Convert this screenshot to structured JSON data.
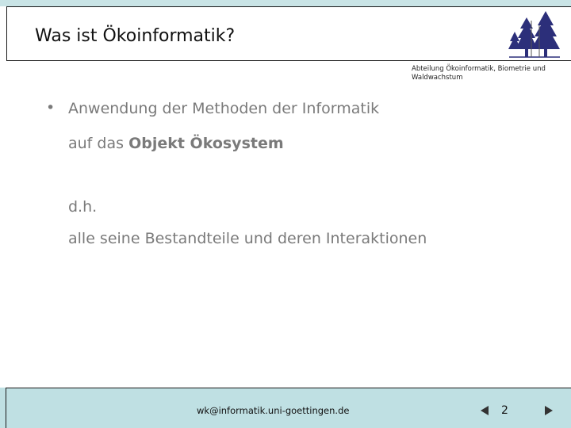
{
  "slide": {
    "title": "Was ist Ökoinformatik?",
    "department": "Abteilung Ökoinformatik, Biometrie und Waldwachstum",
    "bullet_symbol": "•",
    "lines": [
      {
        "text": "Anwendung der Methoden der Informatik"
      },
      {
        "prefix": "auf das ",
        "bold": "Objekt Ökosystem"
      },
      {
        "text": "d.h."
      },
      {
        "text": "alle seine Bestandteile und deren Interaktionen"
      }
    ]
  },
  "footer": {
    "email": "wk@informatik.uni-goettingen.de",
    "page_number": "2"
  },
  "colors": {
    "accent_band": "#c9e4e6",
    "footer_bg": "#bfe0e3",
    "body_text": "#7a7a7a",
    "logo_trees": "#2c2f7a"
  },
  "icons": {
    "logo": "forest-trees-logo",
    "prev": "triangle-left-icon",
    "next": "triangle-right-icon"
  }
}
